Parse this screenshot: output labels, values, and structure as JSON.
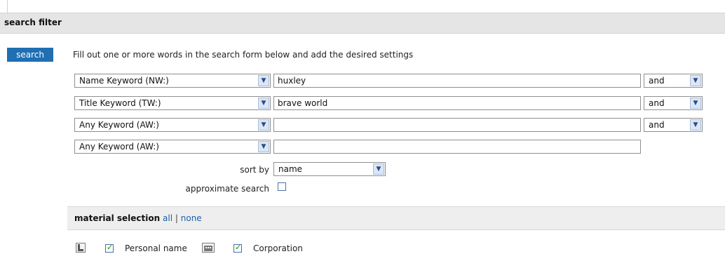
{
  "header": {
    "title": "search filter"
  },
  "search": {
    "button_label": "search",
    "instructions": "Fill out one or more words in the search form below and add the desired settings"
  },
  "rows": [
    {
      "field": "Name Keyword (NW:)",
      "value": "huxley",
      "operator": "and"
    },
    {
      "field": "Title Keyword (TW:)",
      "value": "brave world",
      "operator": "and"
    },
    {
      "field": "Any Keyword (AW:)",
      "value": "",
      "operator": "and"
    },
    {
      "field": "Any Keyword (AW:)",
      "value": ""
    }
  ],
  "sort": {
    "label": "sort by",
    "value": "name"
  },
  "approx": {
    "label": "approximate search",
    "checked": false
  },
  "material": {
    "title": "material selection",
    "all_link": "all",
    "separator": "|",
    "none_link": "none",
    "items": [
      {
        "label": "Personal name",
        "icon": "person-icon",
        "checked": true
      },
      {
        "label": "Corporation",
        "icon": "building-icon",
        "checked": true
      }
    ]
  }
}
